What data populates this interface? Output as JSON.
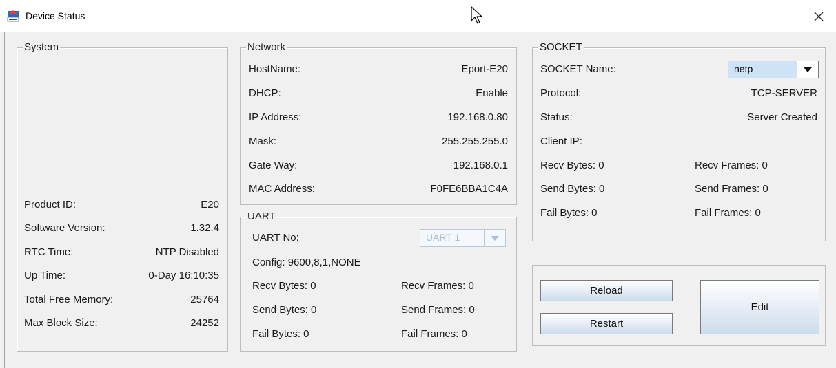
{
  "window": {
    "title": "Device Status",
    "app_icon": "device-app-icon",
    "close_glyph": "✕"
  },
  "system": {
    "title": "System",
    "rows": [
      {
        "label": "Product ID:",
        "value": "E20"
      },
      {
        "label": "Software Version:",
        "value": "1.32.4"
      },
      {
        "label": "RTC Time:",
        "value": "NTP Disabled"
      },
      {
        "label": "Up Time:",
        "value": "0-Day 16:10:35"
      },
      {
        "label": "Total Free Memory:",
        "value": "25764"
      },
      {
        "label": "Max Block Size:",
        "value": "24252"
      }
    ]
  },
  "network": {
    "title": "Network",
    "rows": [
      {
        "label": "HostName:",
        "value": "Eport-E20"
      },
      {
        "label": "DHCP:",
        "value": "Enable"
      },
      {
        "label": "IP Address:",
        "value": "192.168.0.80"
      },
      {
        "label": "Mask:",
        "value": "255.255.255.0"
      },
      {
        "label": "Gate Way:",
        "value": "192.168.0.1"
      },
      {
        "label": "MAC Address:",
        "value": "F0FE6BBA1C4A"
      }
    ]
  },
  "uart": {
    "title": "UART",
    "uart_no_label": "UART No:",
    "uart_no_value": "UART 1",
    "config": "Config: 9600,8,1,NONE",
    "recv_bytes": "Recv Bytes: 0",
    "recv_frames": "Recv Frames: 0",
    "send_bytes": "Send Bytes: 0",
    "send_frames": "Send Frames: 0",
    "fail_bytes": "Fail Bytes: 0",
    "fail_frames": "Fail Frames: 0"
  },
  "socket": {
    "title": "SOCKET",
    "name_label": "SOCKET Name:",
    "name_value": "netp",
    "protocol_label": "Protocol:",
    "protocol_value": "TCP-SERVER",
    "status_label": "Status:",
    "status_value": "Server Created",
    "client_ip_label": "Client IP:",
    "recv_bytes": "Recv Bytes: 0",
    "recv_frames": "Recv Frames: 0",
    "send_bytes": "Send Bytes: 0",
    "send_frames": "Send Frames: 0",
    "fail_bytes": "Fail Bytes: 0",
    "fail_frames": "Fail Frames: 0"
  },
  "actions": {
    "reload": "Reload",
    "restart": "Restart",
    "edit": "Edit"
  },
  "colors": {
    "background": "#f0f0f0",
    "button_gradient_bottom": "#cddcec",
    "combo_selected": "#cfe3f6",
    "disabled_text": "#a9c0d8"
  }
}
